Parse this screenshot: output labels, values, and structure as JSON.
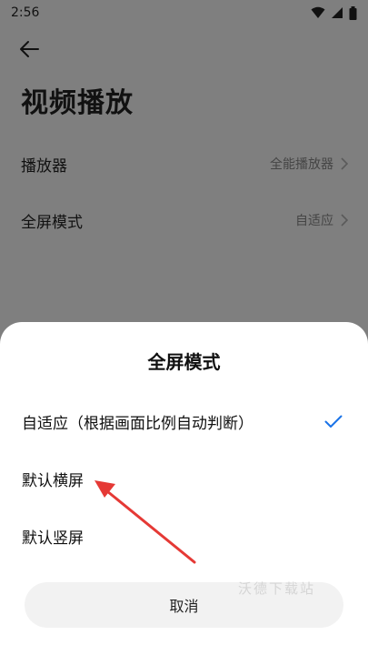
{
  "status_bar": {
    "time": "2:56",
    "icons": [
      "wifi-icon",
      "signal-icon",
      "battery-icon"
    ]
  },
  "header": {
    "back_icon": "arrow-left-icon",
    "title": "视频播放"
  },
  "settings": [
    {
      "label": "播放器",
      "value": "全能播放器"
    },
    {
      "label": "全屏模式",
      "value": "自适应"
    }
  ],
  "sheet": {
    "title": "全屏模式",
    "options": [
      {
        "label": "自适应（根据画面比例自动判断）",
        "selected": true
      },
      {
        "label": "默认横屏",
        "selected": false
      },
      {
        "label": "默认竖屏",
        "selected": false
      }
    ],
    "cancel_label": "取消"
  },
  "watermark": "沃德下载站",
  "colors": {
    "accent": "#1a73e8",
    "arrow": "#e53935",
    "overlay": "#7f7f7f"
  }
}
